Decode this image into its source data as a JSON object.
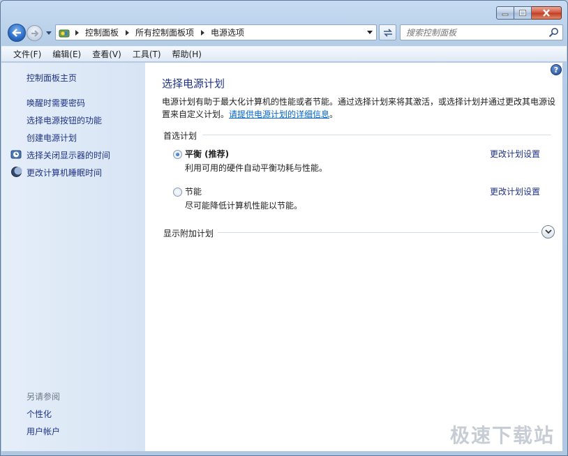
{
  "window": {
    "minimize_icon": "minimize-icon",
    "maximize_icon": "maximize-icon",
    "close_icon": "close-icon"
  },
  "nav": {
    "breadcrumbs": [
      "控制面板",
      "所有控制面板项",
      "电源选项"
    ],
    "search_placeholder": "搜索控制面板"
  },
  "menu": {
    "items": [
      "文件(F)",
      "编辑(E)",
      "查看(V)",
      "工具(T)",
      "帮助(H)"
    ]
  },
  "sidebar": {
    "home": "控制面板主页",
    "links": [
      "唤醒时需要密码",
      "选择电源按钮的功能",
      "创建电源计划",
      "选择关闭显示器的时间",
      "更改计算机睡眠时间"
    ],
    "see_also_title": "另请参阅",
    "see_also": [
      "个性化",
      "用户帐户"
    ]
  },
  "main": {
    "title": "选择电源计划",
    "desc_line1": "电源计划有助于最大化计算机的性能或者节能。通过选择计划来将其激活，或选择计划并通过更改其电源设",
    "desc_line2_prefix": "置来自定义计划。",
    "desc_link": "请提供电源计划的详细信息",
    "desc_suffix": "。",
    "preferred_label": "首选计划",
    "plans": [
      {
        "name": "平衡 (推荐)",
        "desc": "利用可用的硬件自动平衡功耗与性能。",
        "change": "更改计划设置",
        "selected": true
      },
      {
        "name": "节能",
        "desc": "尽可能降低计算机性能以节能。",
        "change": "更改计划设置",
        "selected": false
      }
    ],
    "more_plans_label": "显示附加计划"
  },
  "watermark": "极速下载站"
}
